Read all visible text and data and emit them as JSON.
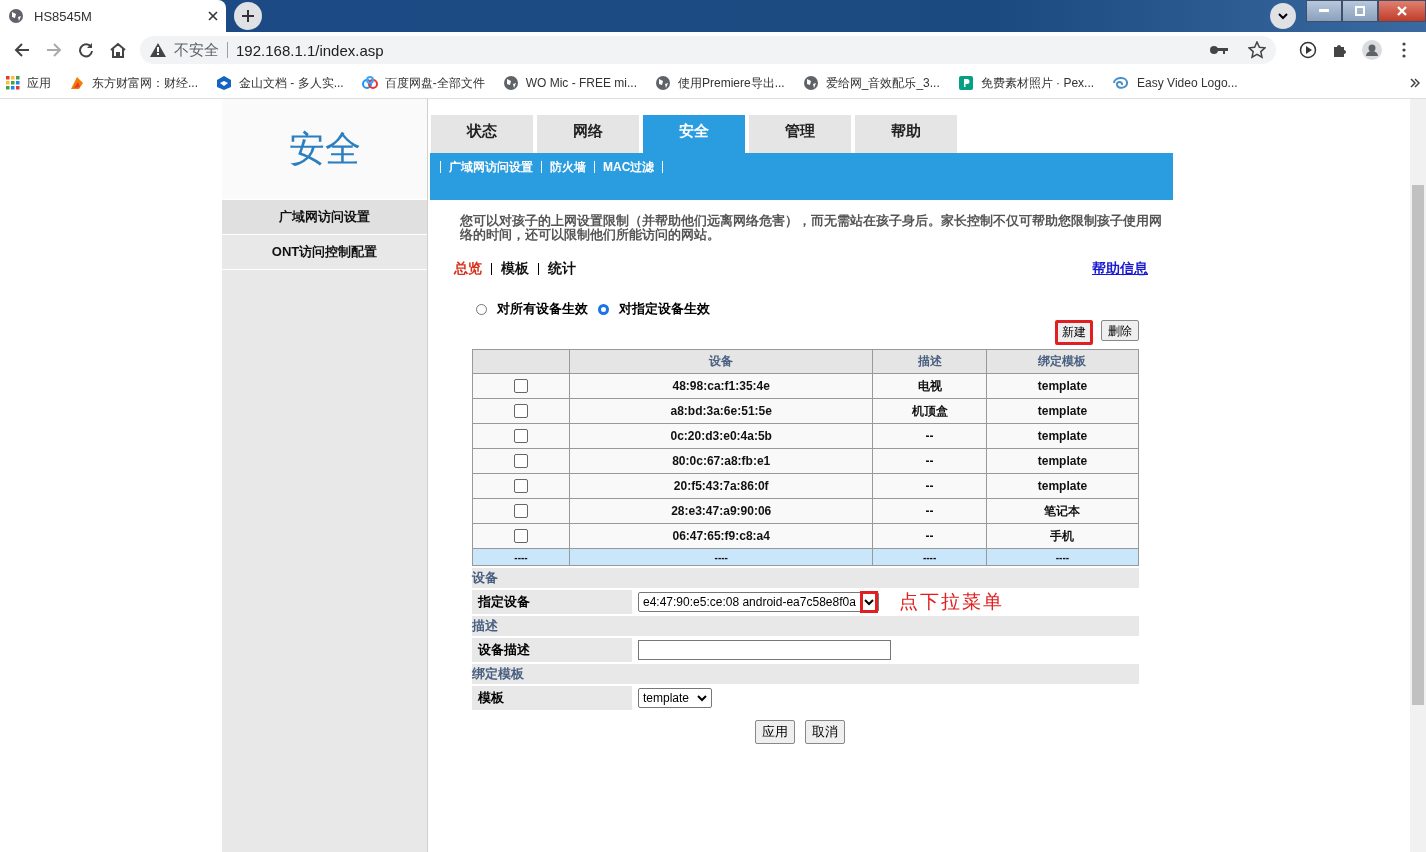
{
  "browser": {
    "tab_title": "HS8545M",
    "security_label": "不安全",
    "url": "192.168.1.1/index.asp",
    "bookmarks": [
      {
        "label": "应用",
        "kind": "apps"
      },
      {
        "label": "东方财富网：财经...",
        "kind": "flame"
      },
      {
        "label": "金山文档 - 多人实...",
        "kind": "cube"
      },
      {
        "label": "百度网盘-全部文件",
        "kind": "cloud"
      },
      {
        "label": "WO Mic - FREE mi...",
        "kind": "globe"
      },
      {
        "label": "使用Premiere导出...",
        "kind": "globe"
      },
      {
        "label": "爱给网_音效配乐_3...",
        "kind": "globe"
      },
      {
        "label": "免费素材照片 · Pex...",
        "kind": "pexels"
      },
      {
        "label": "Easy Video Logo...",
        "kind": "swirl"
      }
    ]
  },
  "sidebar": {
    "title": "安全",
    "items": [
      {
        "label": "广域网访问设置",
        "selected": true
      },
      {
        "label": "ONT访问控制配置",
        "selected": false
      }
    ]
  },
  "tabs": [
    {
      "label": "状态",
      "selected": false
    },
    {
      "label": "网络",
      "selected": false
    },
    {
      "label": "安全",
      "selected": true
    },
    {
      "label": "管理",
      "selected": false
    },
    {
      "label": "帮助",
      "selected": false
    }
  ],
  "subnav": [
    "广域网访问设置",
    "防火墙",
    "MAC过滤"
  ],
  "description": "您可以对孩子的上网设置限制（并帮助他们远离网络危害），而无需站在孩子身后。家长控制不仅可帮助您限制孩子使用网络的时间，还可以限制他们所能访问的网站。",
  "views": [
    {
      "label": "总览",
      "selected": true
    },
    {
      "label": "模板",
      "selected": false
    },
    {
      "label": "统计",
      "selected": false
    }
  ],
  "help_link": "帮助信息",
  "scope_options": [
    {
      "label": "对所有设备生效",
      "selected": false
    },
    {
      "label": "对指定设备生效",
      "selected": true
    }
  ],
  "table_buttons": [
    {
      "label": "新建",
      "highlighted": true
    },
    {
      "label": "删除",
      "highlighted": false
    }
  ],
  "table": {
    "columns": [
      "设备",
      "描述",
      "绑定模板"
    ],
    "rows": [
      {
        "checked": false,
        "cells": [
          "48:98:ca:f1:35:4e",
          "电视",
          "template"
        ]
      },
      {
        "checked": false,
        "cells": [
          "a8:bd:3a:6e:51:5e",
          "机顶盒",
          "template"
        ]
      },
      {
        "checked": false,
        "cells": [
          "0c:20:d3:e0:4a:5b",
          "--",
          "template"
        ]
      },
      {
        "checked": false,
        "cells": [
          "80:0c:67:a8:fb:e1",
          "--",
          "template"
        ]
      },
      {
        "checked": false,
        "cells": [
          "20:f5:43:7a:86:0f",
          "--",
          "template"
        ]
      },
      {
        "checked": false,
        "cells": [
          "28:e3:47:a9:90:06",
          "--",
          "笔记本"
        ]
      },
      {
        "checked": false,
        "cells": [
          "06:47:65:f9:c8:a4",
          "--",
          "手机"
        ]
      }
    ],
    "new_row": [
      "----",
      "----",
      "----",
      "----"
    ]
  },
  "form": [
    {
      "heading": "设备",
      "label": "指定设备",
      "kind": "select",
      "value": "e4:47:90:e5:ce:08  android-ea7c58e8f0a",
      "highlighted": true,
      "note": "点下拉菜单"
    },
    {
      "heading": "描述",
      "label": "设备描述",
      "kind": "text"
    },
    {
      "heading": "绑定模板",
      "label": "模板",
      "kind": "select",
      "value": "template"
    }
  ],
  "actions": [
    "应用",
    "取消"
  ]
}
